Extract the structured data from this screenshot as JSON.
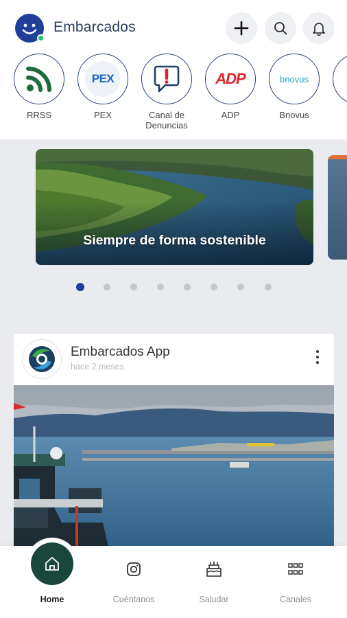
{
  "header": {
    "title": "Embarcados",
    "logo_icon": "smiley-face-icon",
    "status_color": "#22c26b",
    "brand_color": "#1f3f9a"
  },
  "channels": [
    {
      "label": "RRSS",
      "icon": "rss-icon"
    },
    {
      "label": "PEX",
      "icon": "pex-logo"
    },
    {
      "label": "Canal de Denuncias",
      "icon": "report-speech-icon"
    },
    {
      "label": "ADP",
      "icon": "adp-logo"
    },
    {
      "label": "Bnovus",
      "icon": "bnovus-logo"
    }
  ],
  "channel_logos": {
    "pex": "PEX",
    "adp": "ADP",
    "bnovus": "bnovus"
  },
  "carousel": {
    "banner_text": "Siempre de forma sostenible",
    "active_index": 0,
    "total": 8
  },
  "post": {
    "author": "Embarcados App",
    "time": "hace 2 meses"
  },
  "nav": {
    "items": [
      {
        "label": "Home",
        "icon": "home-icon"
      },
      {
        "label": "Cuéntanos",
        "icon": "instagram-icon"
      },
      {
        "label": "Saludar",
        "icon": "birthday-cake-icon"
      },
      {
        "label": "Canales",
        "icon": "grid-icon"
      }
    ],
    "active_color": "#19473c"
  }
}
